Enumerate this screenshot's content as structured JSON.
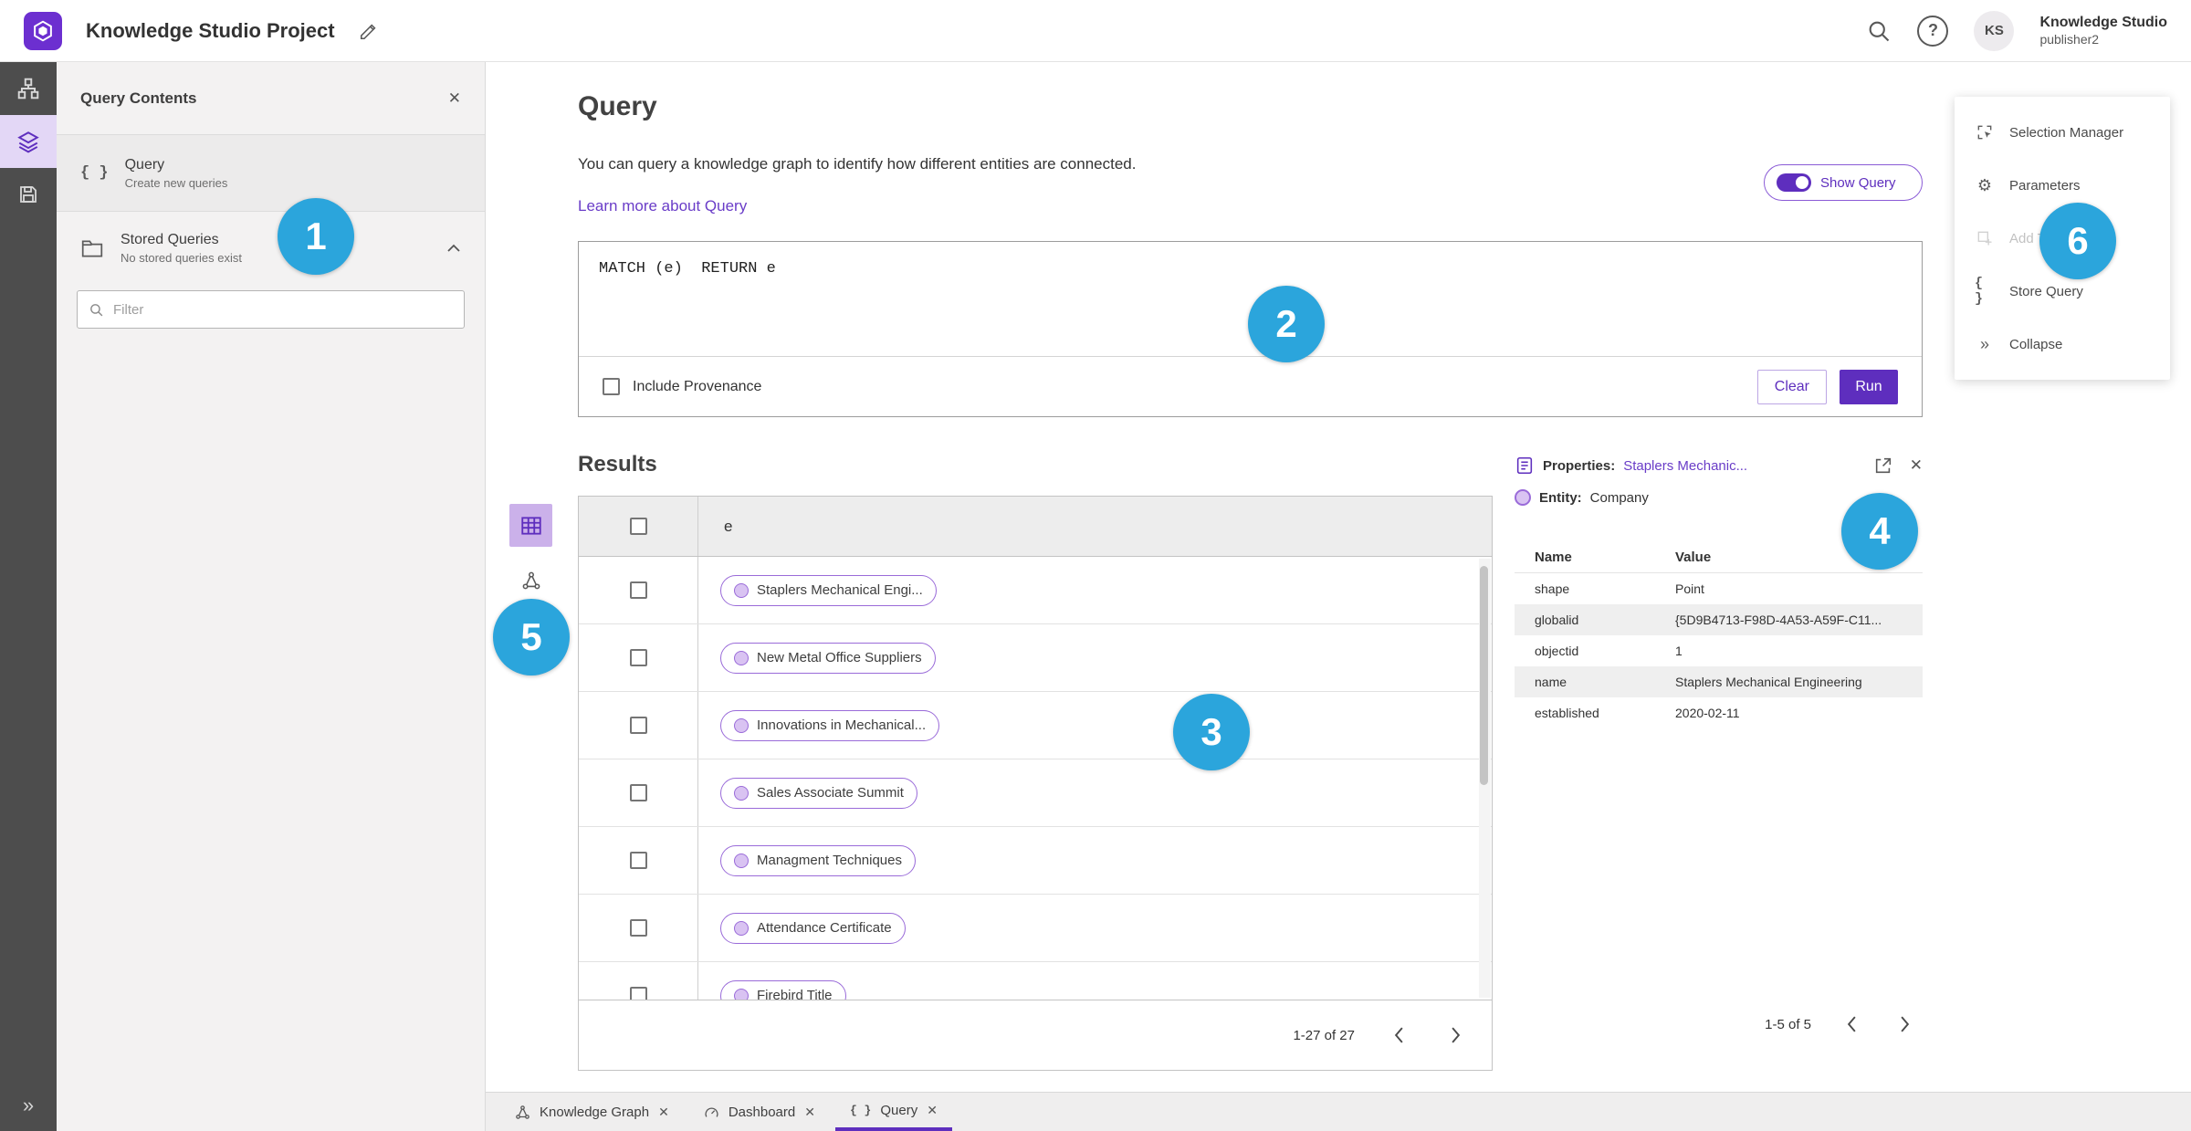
{
  "topbar": {
    "title": "Knowledge Studio Project",
    "account_name": "Knowledge Studio",
    "account_sub": "publisher2",
    "avatar": "KS"
  },
  "left_panel": {
    "title": "Query Contents",
    "query_item": {
      "label": "Query",
      "sub": "Create new queries"
    },
    "stored_item": {
      "label": "Stored Queries",
      "sub": "No stored queries exist"
    },
    "filter_placeholder": "Filter"
  },
  "query": {
    "title": "Query",
    "description": "You can query a knowledge graph to identify how different entities are connected.",
    "learn_more": "Learn more about Query",
    "show_query": "Show Query",
    "text": "MATCH (e)  RETURN e",
    "include_provenance": "Include Provenance",
    "clear": "Clear",
    "run": "Run"
  },
  "results": {
    "title": "Results",
    "column": "e",
    "rows": [
      "Staplers Mechanical Engi...",
      "New Metal Office Suppliers",
      "Innovations in Mechanical...",
      "Sales Associate Summit",
      "Managment Techniques",
      "Attendance Certificate",
      "Firebird Title"
    ],
    "pagination": "1-27 of 27"
  },
  "properties": {
    "label": "Properties:",
    "entity_name": "Staplers Mechanic...",
    "entity_label": "Entity:",
    "entity_type": "Company",
    "col_name": "Name",
    "col_value": "Value",
    "rows": [
      {
        "name": "shape",
        "value": "Point"
      },
      {
        "name": "globalid",
        "value": "{5D9B4713-F98D-4A53-A59F-C11..."
      },
      {
        "name": "objectid",
        "value": "1"
      },
      {
        "name": "name",
        "value": "Staplers Mechanical Engineering"
      },
      {
        "name": "established",
        "value": "2020-02-11"
      }
    ],
    "pagination": "1-5 of 5"
  },
  "side_menu": {
    "items": [
      "Selection Manager",
      "Parameters",
      "Add To Map",
      "Store Query",
      "Collapse"
    ]
  },
  "tabs": [
    "Knowledge Graph",
    "Dashboard",
    "Query"
  ],
  "annotations": [
    "1",
    "2",
    "3",
    "4",
    "5",
    "6"
  ],
  "colors": {
    "accent": "#5E2EBE",
    "annotation": "#2BA5DC",
    "pill_border": "#9A6BD9",
    "pill_fill": "#D9C3F2"
  }
}
